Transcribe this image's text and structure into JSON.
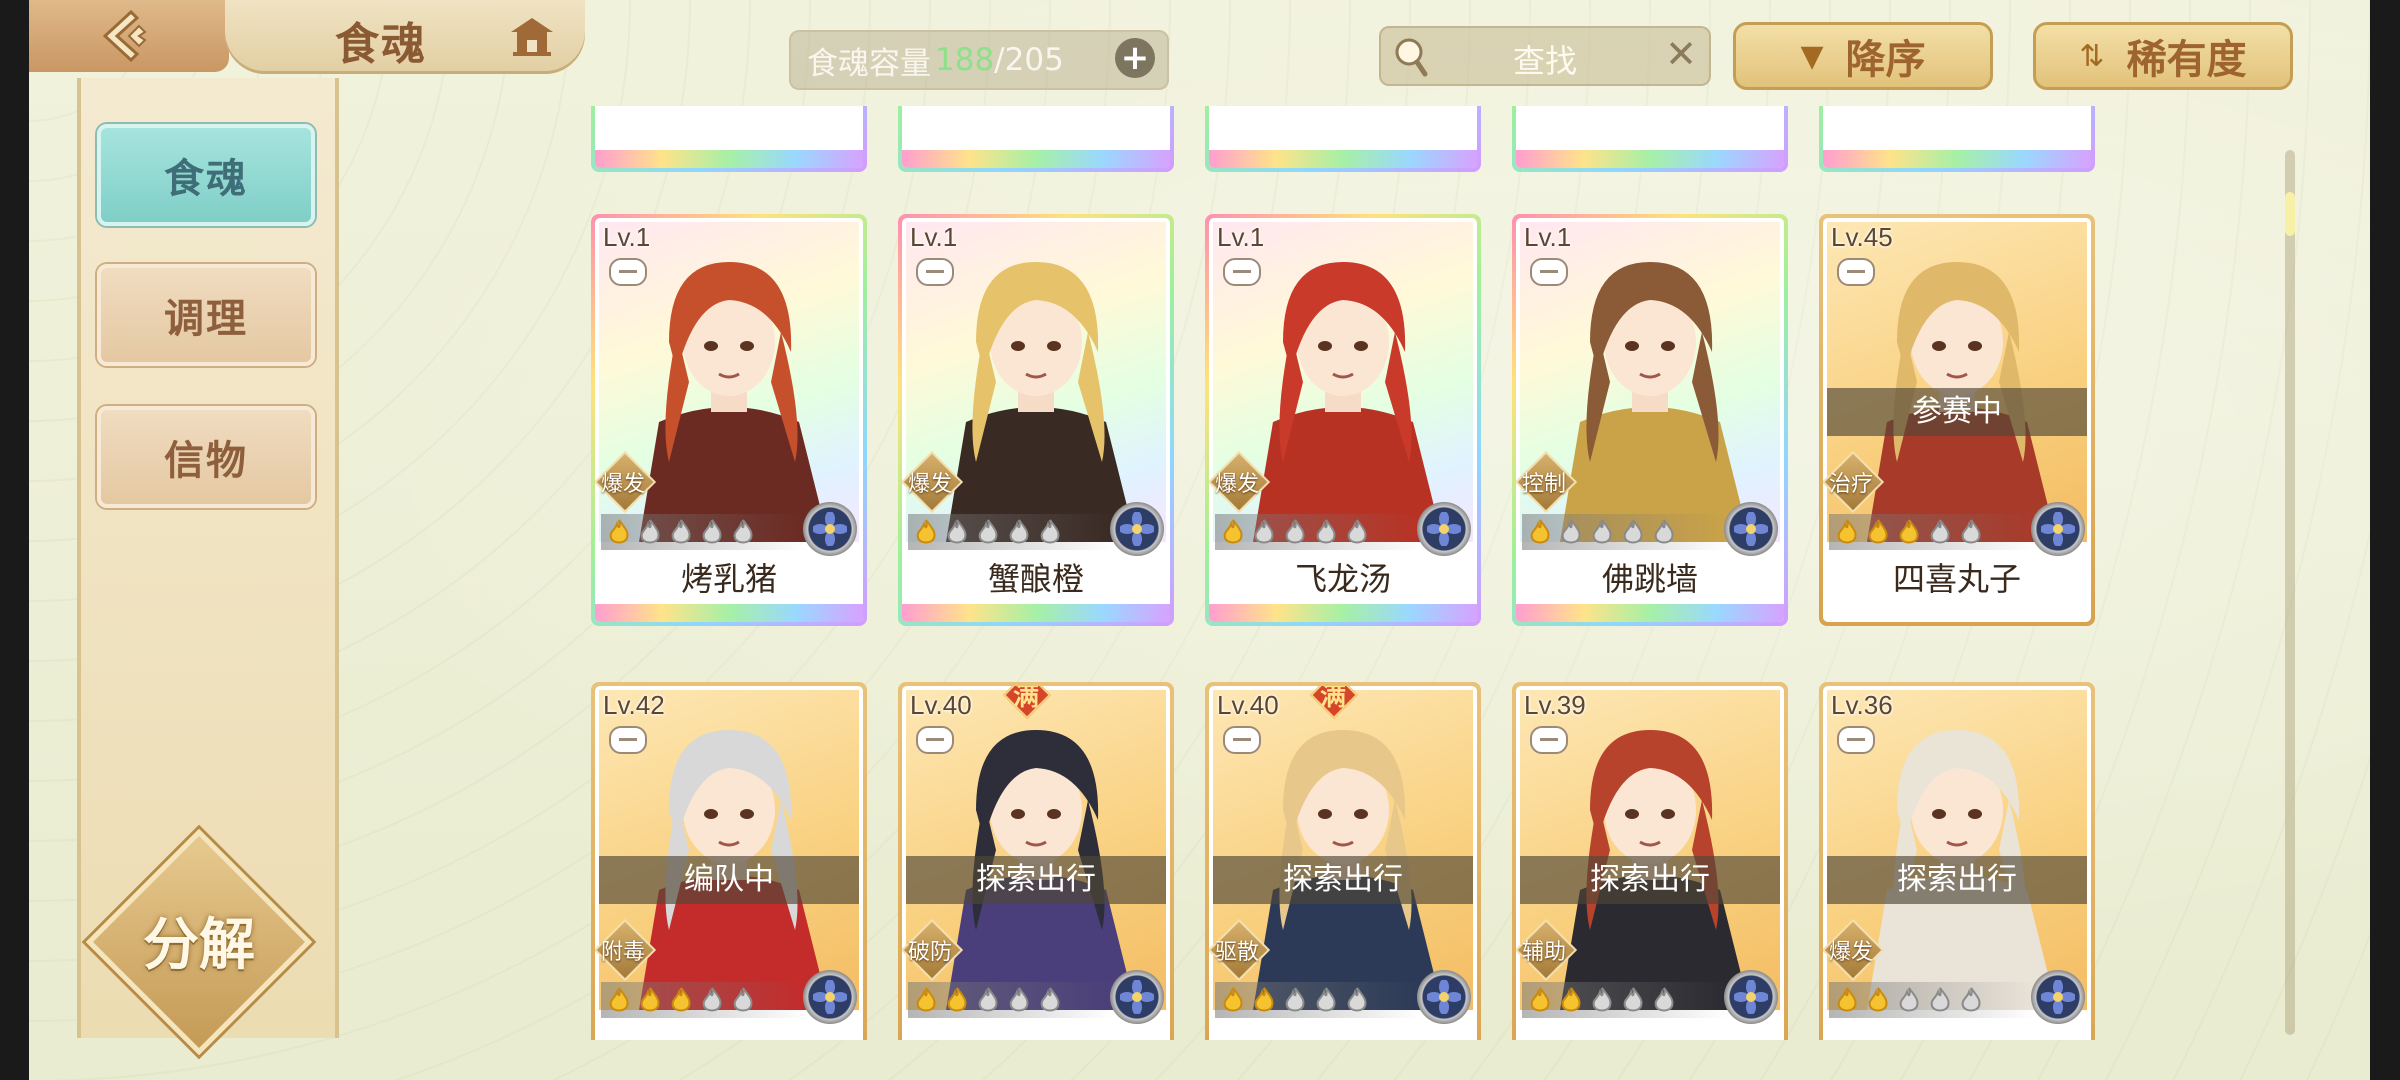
{
  "header": {
    "title": "食魂",
    "capacity_label": "食魂容量",
    "capacity_used": "188",
    "capacity_sep": "/",
    "capacity_total": "205",
    "search_label": "查找",
    "sort_order_label": "降序",
    "sort_key_label": "稀有度"
  },
  "sidebar": {
    "items": [
      {
        "label": "食魂",
        "active": true
      },
      {
        "label": "调理",
        "active": false
      },
      {
        "label": "信物",
        "active": false
      }
    ],
    "decompose_label": "分解"
  },
  "rows": [
    {
      "cards": [
        {
          "level": "Lv.1",
          "role": "爆发",
          "stars_lit": 1,
          "name": "烤乳猪",
          "frame": "rainbow",
          "status": "",
          "maxed": false
        },
        {
          "level": "Lv.1",
          "role": "爆发",
          "stars_lit": 1,
          "name": "蟹酿橙",
          "frame": "rainbow",
          "status": "",
          "maxed": false
        },
        {
          "level": "Lv.1",
          "role": "爆发",
          "stars_lit": 1,
          "name": "飞龙汤",
          "frame": "rainbow",
          "status": "",
          "maxed": false
        },
        {
          "level": "Lv.1",
          "role": "控制",
          "stars_lit": 1,
          "name": "佛跳墙",
          "frame": "rainbow",
          "status": "",
          "maxed": false
        },
        {
          "level": "Lv.45",
          "role": "治疗",
          "stars_lit": 3,
          "name": "四喜丸子",
          "frame": "gold",
          "status": "参赛中",
          "maxed": false
        }
      ]
    },
    {
      "cards": [
        {
          "level": "Lv.42",
          "role": "附毒",
          "stars_lit": 3,
          "name": "",
          "frame": "gold",
          "status": "编队中",
          "maxed": false
        },
        {
          "level": "Lv.40",
          "role": "破防",
          "stars_lit": 2,
          "name": "",
          "frame": "gold",
          "status": "探索出行",
          "maxed": true
        },
        {
          "level": "Lv.40",
          "role": "驱散",
          "stars_lit": 2,
          "name": "",
          "frame": "gold",
          "status": "探索出行",
          "maxed": true
        },
        {
          "level": "Lv.39",
          "role": "辅助",
          "stars_lit": 2,
          "name": "",
          "frame": "gold",
          "status": "探索出行",
          "maxed": false
        },
        {
          "level": "Lv.36",
          "role": "爆发",
          "stars_lit": 2,
          "name": "",
          "frame": "gold",
          "status": "探索出行",
          "maxed": false
        }
      ]
    }
  ],
  "full_badge_label": "满",
  "colors": {
    "accent": "#7fcfc7",
    "gold": "#d8a24f",
    "capacity_used": "#8fe08a"
  }
}
